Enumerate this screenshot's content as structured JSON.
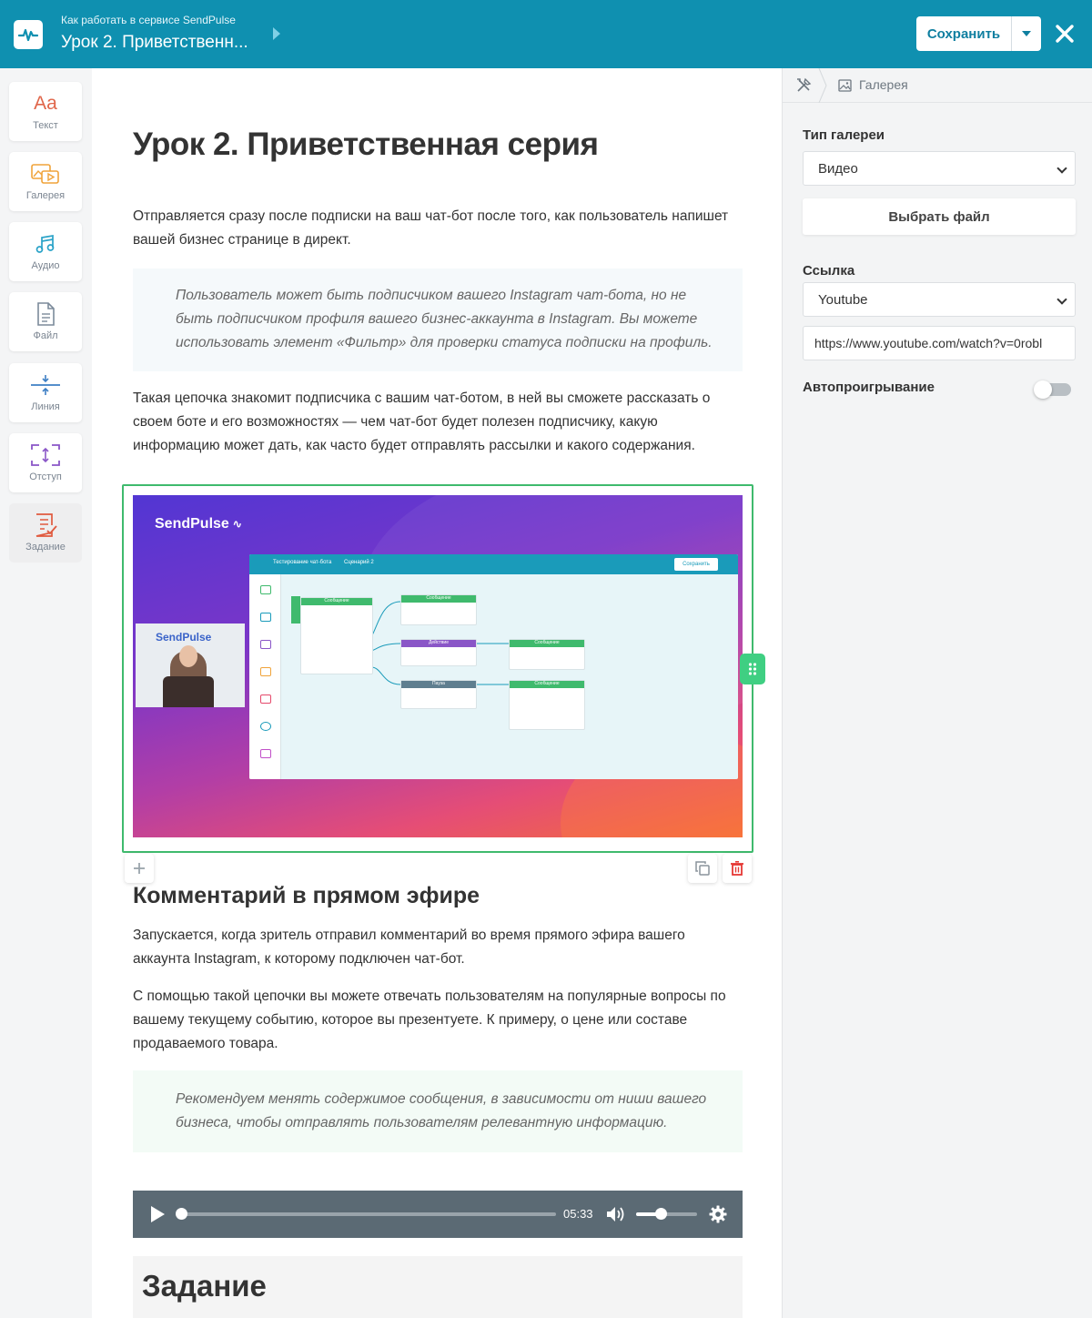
{
  "header": {
    "course_title": "Как работать в сервисе SendPulse",
    "lesson_title": "Урок 2. Приветственн...",
    "save_label": "Сохранить",
    "bg_color": "#0f90b0"
  },
  "toolbar": {
    "items": [
      {
        "label": "Текст",
        "icon": "text-icon"
      },
      {
        "label": "Галерея",
        "icon": "gallery-icon"
      },
      {
        "label": "Аудио",
        "icon": "music-note-icon"
      },
      {
        "label": "Файл",
        "icon": "file-icon"
      },
      {
        "label": "Линия",
        "icon": "line-divider-icon"
      },
      {
        "label": "Отступ",
        "icon": "spacing-icon"
      },
      {
        "label": "Задание",
        "icon": "task-icon",
        "disabled": true
      }
    ]
  },
  "content": {
    "title": "Урок 2. Приветственная серия",
    "intro": "Отправляется сразу после подписки на ваш чат-бот после того, как пользователь напишет вашей бизнес странице в директ.",
    "quote1": "Пользователь может быть подписчиком вашего Instagram чат-бота, но не быть подписчиком профиля вашего бизнес-аккаунта в Instagram. Вы можете использовать элемент «Фильтр» для проверки статуса подписки на профиль.",
    "para2": "Такая цепочка знакомит подписчика с вашим чат-ботом, в ней вы сможете рассказать о своем боте и его возможностях — чем чат-бот будет полезен подписчику, какую информацию может дать, как часто будет отправлять рассылки и какого содержания.",
    "video": {
      "brand": "SendPulse",
      "webcam_brand": "SendPulse",
      "app_tab1": "Тестирование чат-бота",
      "app_tab2": "Сценарий 2",
      "app_save": "Сохранить",
      "nodes": [
        "Сообщение",
        "Сообщение",
        "Действие",
        "Сообщение",
        "Пауза",
        "Сообщение"
      ]
    },
    "section_title": "Комментарий в прямом эфире",
    "para3": "Запускается, когда зритель отправил комментарий во время прямого эфира вашего аккаунта Instagram, к которому подключен чат-бот.",
    "para4": "С помощью такой цепочки вы можете отвечать пользователям на популярные вопросы по вашему текущему событию, которое вы презентуете. К примеру, о цене или составе продаваемого товара.",
    "quote2": "Рекомендуем менять содержимое сообщения, в зависимости от ниши вашего бизнеса, чтобы отправлять пользователям релевантную информацию.",
    "audio": {
      "time": "05:33",
      "progress": 0,
      "volume": 0.4
    },
    "task_title": "Задание"
  },
  "panel": {
    "breadcrumb": "Галерея",
    "gallery_type_label": "Тип галереи",
    "gallery_type_value": "Видео",
    "choose_file_label": "Выбрать файл",
    "link_label": "Ссылка",
    "link_source_value": "Youtube",
    "link_url_value": "https://www.youtube.com/watch?v=0robl",
    "autoplay_label": "Автопроигрывание",
    "autoplay_on": false
  },
  "colors": {
    "accent": "#0f90b0",
    "selection": "#3fba6d",
    "delete": "#e53935"
  }
}
